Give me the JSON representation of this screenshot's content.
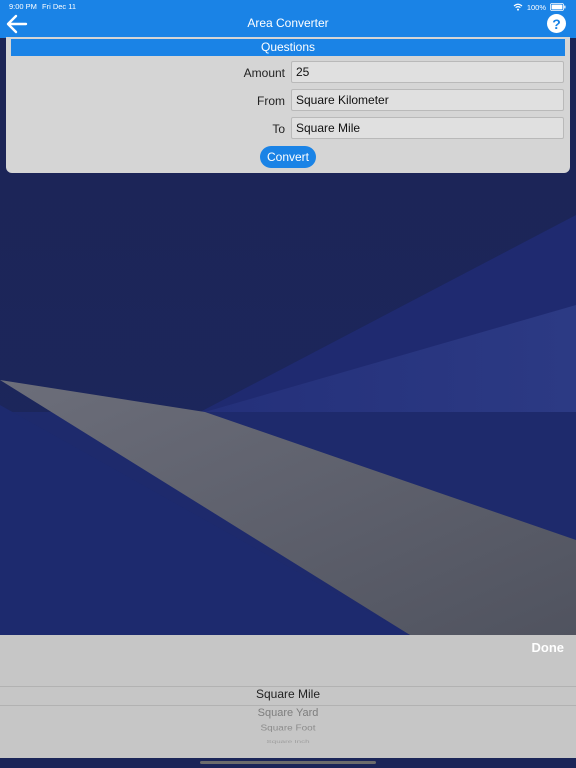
{
  "status_bar": {
    "time": "9:00 PM",
    "date": "Fri Dec 11",
    "battery": "100%"
  },
  "nav": {
    "title": "Area Converter",
    "back_icon": "arrow-left-icon",
    "help_icon": "question-circle-icon",
    "help_glyph": "?"
  },
  "form": {
    "section_header": "Questions",
    "amount_label": "Amount",
    "amount_value": "25",
    "from_label": "From",
    "from_value": "Square Kilometer",
    "to_label": "To",
    "to_value": "Square Mile",
    "convert_label": "Convert"
  },
  "picker": {
    "done_label": "Done",
    "items": [
      "Square Mile",
      "Square Yard",
      "Square Foot",
      "Square Inch"
    ]
  },
  "colors": {
    "accent": "#1a83e6",
    "background": "#1b2558",
    "panel": "#d5d5d5",
    "picker": "#c6c6c6"
  }
}
